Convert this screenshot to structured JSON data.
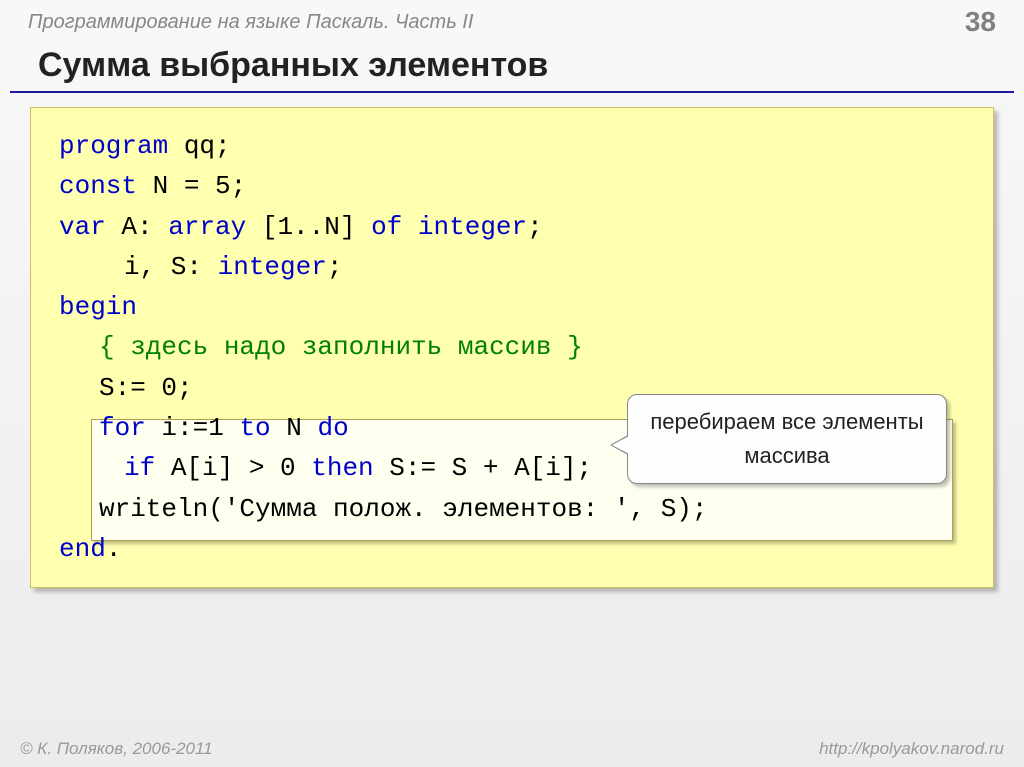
{
  "header": {
    "subject": "Программирование на языке Паскаль. Часть II",
    "page_number": "38"
  },
  "title": "Сумма выбранных элементов",
  "code": {
    "l1_kw": "program",
    "l1_rest": " qq;",
    "l2_kw": "const",
    "l2_rest": " N = 5;",
    "l3_kw1": "var",
    "l3_mid": " A: ",
    "l3_kw2": "array",
    "l3_mid2": " [1..N] ",
    "l3_kw3": "of",
    "l3_mid3": " ",
    "l3_kw4": "integer",
    "l3_end": ";",
    "l4_mid": "i, S: ",
    "l4_kw": "integer",
    "l4_end": ";",
    "l5_kw": "begin",
    "l6_cmt": "{ здесь надо заполнить массив }",
    "l7": "S:= 0;",
    "l8_kw1": "for",
    "l8_mid1": " i:=1 ",
    "l8_kw2": "to",
    "l8_mid2": " N ",
    "l8_kw3": "do",
    "l9_kw1": "if",
    "l9_mid1": " A[i] > 0 ",
    "l9_kw2": "then",
    "l9_mid2": " S:= S + A[i];",
    "l10_pre": "writeln(",
    "l10_str": "'Сумма полож. элементов: '",
    "l10_post": ", S);",
    "l11_kw": "end",
    "l11_end": "."
  },
  "callout": "перебираем все элементы массива",
  "footer": {
    "copyright": "© К. Поляков, 2006-2011",
    "url": "http://kpolyakov.narod.ru"
  }
}
